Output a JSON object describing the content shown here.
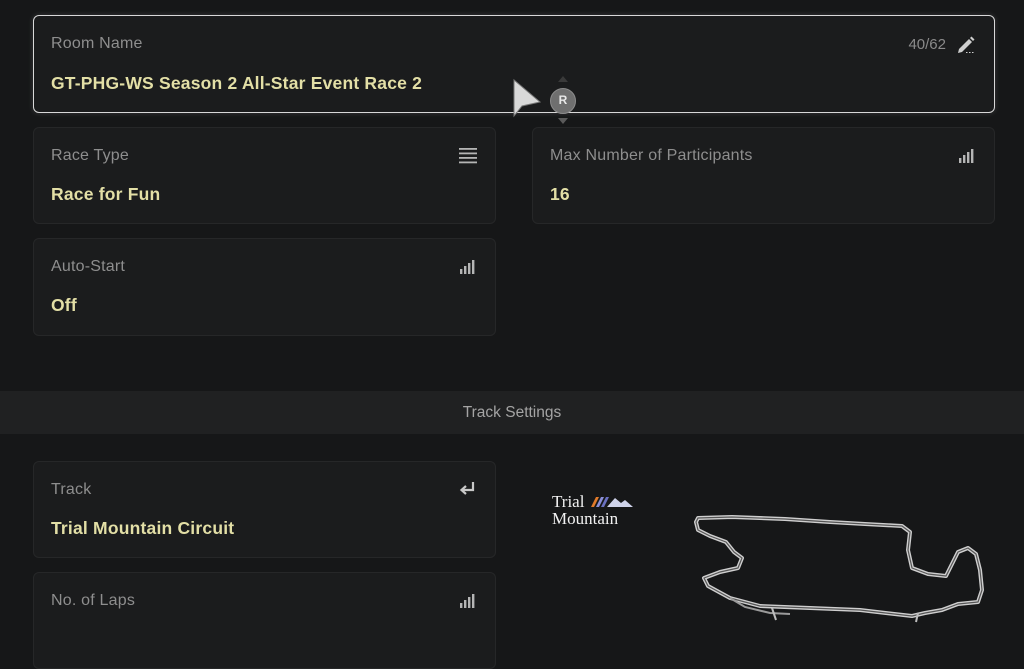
{
  "room_name": {
    "label": "Room Name",
    "value": "GT-PHG-WS Season 2 All-Star Event Race 2",
    "counter": "40/62",
    "icon": "pencil-icon"
  },
  "race_type": {
    "label": "Race Type",
    "value": "Race for Fun",
    "icon": "list-icon"
  },
  "max_participants": {
    "label": "Max Number of Participants",
    "value": "16",
    "icon": "bars-icon"
  },
  "auto_start": {
    "label": "Auto-Start",
    "value": "Off",
    "icon": "bars-icon"
  },
  "track_settings": {
    "section_title": "Track Settings"
  },
  "track": {
    "label": "Track",
    "value": "Trial Mountain Circuit",
    "icon": "enter-icon",
    "logo_line1": "Trial",
    "logo_line2": "Mountain"
  },
  "laps": {
    "label": "No. of Laps",
    "icon": "bars-icon"
  },
  "controller_hint": {
    "button": "R"
  },
  "colors": {
    "background": "#161718",
    "card": "#1b1c1d",
    "value_text": "#e3dfa6",
    "label_text": "#8e8e8e",
    "selected_border": "#d8d8d8"
  }
}
